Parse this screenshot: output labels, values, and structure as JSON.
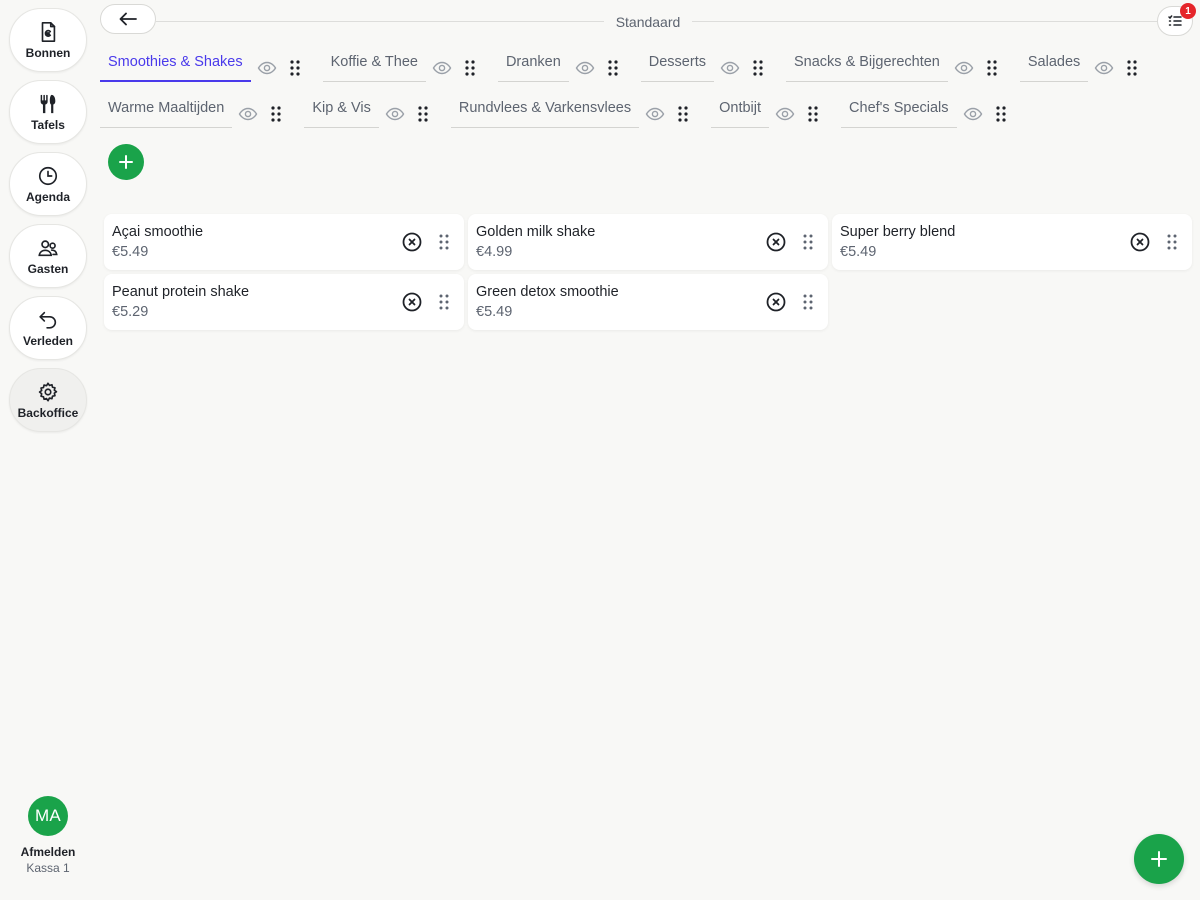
{
  "sidebar": {
    "items": [
      {
        "label": "Bonnen",
        "icon": "receipt-euro-icon"
      },
      {
        "label": "Tafels",
        "icon": "fork-knife-icon"
      },
      {
        "label": "Agenda",
        "icon": "clock-icon"
      },
      {
        "label": "Gasten",
        "icon": "users-icon"
      },
      {
        "label": "Verleden",
        "icon": "undo-arrow-icon"
      },
      {
        "label": "Backoffice",
        "icon": "gear-icon"
      }
    ],
    "user_initials": "MA",
    "logout_label": "Afmelden",
    "register_label": "Kassa 1"
  },
  "header": {
    "title": "Standaard",
    "notification_count": "1"
  },
  "tabs": {
    "row1": [
      {
        "label": "Smoothies & Shakes",
        "active": true
      },
      {
        "label": "Koffie & Thee"
      },
      {
        "label": "Dranken"
      },
      {
        "label": "Desserts"
      },
      {
        "label": "Snacks & Bijgerechten"
      },
      {
        "label": "Salades"
      }
    ],
    "row2": [
      {
        "label": "Warme Maaltijden"
      },
      {
        "label": "Kip & Vis"
      },
      {
        "label": "Rundvlees & Varkensvlees"
      },
      {
        "label": "Ontbijt"
      },
      {
        "label": "Chef's Specials"
      }
    ]
  },
  "products": [
    {
      "name": "Açai smoothie",
      "price": "€5.49"
    },
    {
      "name": "Golden milk shake",
      "price": "€4.99"
    },
    {
      "name": "Super berry blend",
      "price": "€5.49"
    },
    {
      "name": "Peanut protein shake",
      "price": "€5.29"
    },
    {
      "name": "Green detox smoothie",
      "price": "€5.49"
    }
  ],
  "colors": {
    "accent": "#4a3aeb",
    "primary_green": "#1aa34a",
    "badge_red": "#e5252a",
    "background": "#f8f8f6"
  }
}
